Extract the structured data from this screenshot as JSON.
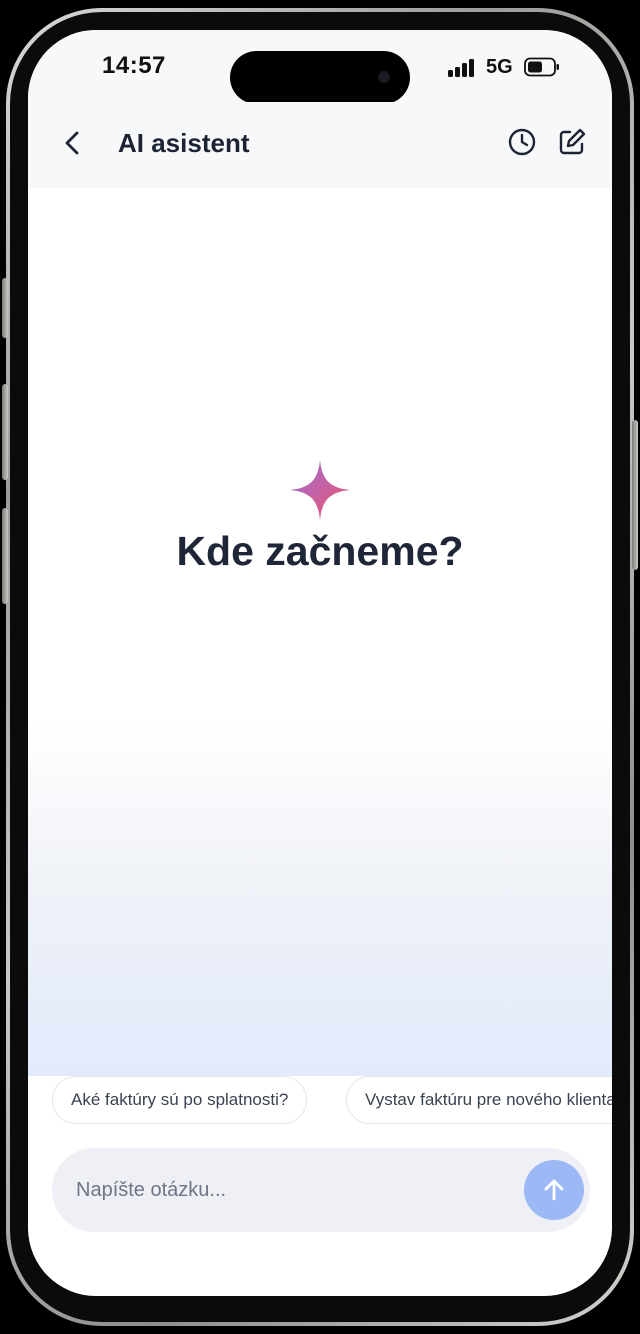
{
  "status_bar": {
    "time": "14:57",
    "network": "5G"
  },
  "header": {
    "title": "AI asistent",
    "back_icon": "chevron-left-icon",
    "history_icon": "clock-icon",
    "compose_icon": "compose-icon"
  },
  "main": {
    "icon": "sparkle-icon",
    "heading": "Kde začneme?"
  },
  "suggestions": [
    {
      "label": "Aké faktúry sú po splatnosti?"
    },
    {
      "label": "Vystav faktúru pre nového klienta"
    }
  ],
  "composer": {
    "placeholder": "Napíšte otázku...",
    "send_icon": "arrow-up-icon"
  },
  "colors": {
    "accent": "#9cb8f5",
    "title_text": "#1c2434",
    "sparkle_start": "#9b6fd8",
    "sparkle_end": "#f0546c"
  }
}
